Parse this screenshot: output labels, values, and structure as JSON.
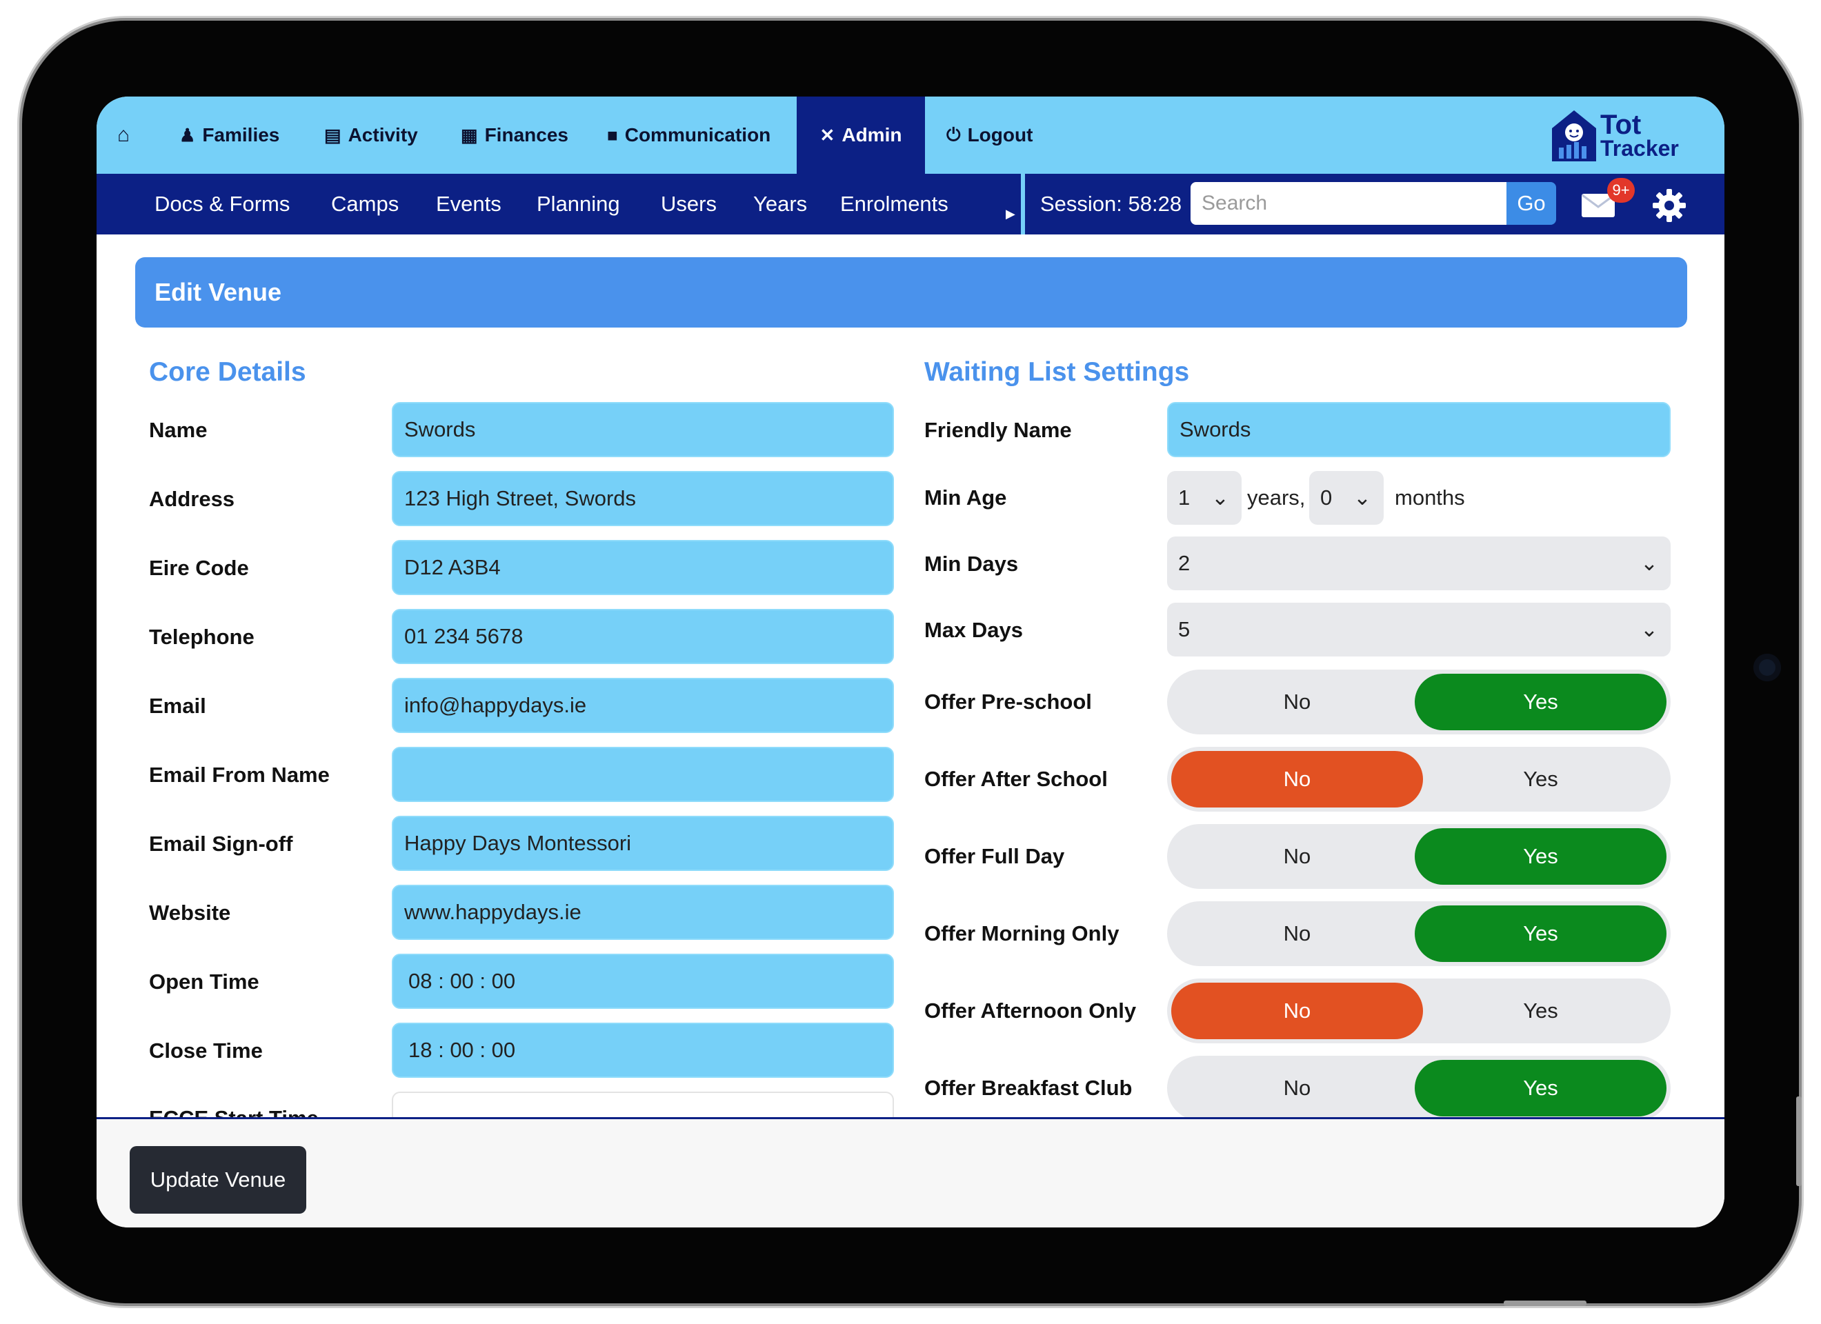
{
  "topnav": {
    "home_icon": "home-icon",
    "items": [
      {
        "label": "Families",
        "icon": "users-icon"
      },
      {
        "label": "Activity",
        "icon": "clipboard-icon"
      },
      {
        "label": "Finances",
        "icon": "ledger-icon"
      },
      {
        "label": "Communication",
        "icon": "chat-icon"
      },
      {
        "label": "Admin",
        "icon": "tools-icon"
      },
      {
        "label": "Logout",
        "icon": "power-icon"
      }
    ],
    "logo": {
      "line1": "Tot",
      "line2": "Tracker"
    }
  },
  "subnav": {
    "links": [
      "Docs & Forms",
      "Camps",
      "Events",
      "Planning",
      "Users",
      "Years",
      "Enrolments"
    ],
    "more_icon": "caret-right-icon",
    "session": "Session: 58:28",
    "search_placeholder": "Search",
    "go_label": "Go",
    "badge": "9+"
  },
  "page": {
    "title": "Edit Venue"
  },
  "core": {
    "title": "Core Details",
    "fields": [
      {
        "label": "Name",
        "value": "Swords"
      },
      {
        "label": "Address",
        "value": "123 High Street, Swords"
      },
      {
        "label": "Eire Code",
        "value": "D12 A3B4"
      },
      {
        "label": "Telephone",
        "value": "01 234 5678"
      },
      {
        "label": "Email",
        "value": "info@happydays.ie"
      },
      {
        "label": "Email From Name",
        "value": ""
      },
      {
        "label": "Email Sign-off",
        "value": "Happy Days Montessori"
      },
      {
        "label": "Website",
        "value": "www.happydays.ie"
      },
      {
        "label": "Open Time",
        "value": "08 : 00 : 00"
      },
      {
        "label": "Close Time",
        "value": "18 : 00 : 00"
      },
      {
        "label": "ECCE Start Time",
        "value": ""
      }
    ]
  },
  "waiting": {
    "title": "Waiting List Settings",
    "friendly_name": {
      "label": "Friendly Name",
      "value": "Swords"
    },
    "min_age": {
      "label": "Min Age",
      "years": "1",
      "years_unit": "years,",
      "months": "0",
      "months_unit": "months"
    },
    "min_days": {
      "label": "Min Days",
      "value": "2"
    },
    "max_days": {
      "label": "Max Days",
      "value": "5"
    },
    "toggles": [
      {
        "label": "Offer Pre-school",
        "no": "No",
        "yes": "Yes",
        "selected": "Yes"
      },
      {
        "label": "Offer After School",
        "no": "No",
        "yes": "Yes",
        "selected": "No"
      },
      {
        "label": "Offer Full Day",
        "no": "No",
        "yes": "Yes",
        "selected": "Yes"
      },
      {
        "label": "Offer Morning Only",
        "no": "No",
        "yes": "Yes",
        "selected": "Yes"
      },
      {
        "label": "Offer Afternoon Only",
        "no": "No",
        "yes": "Yes",
        "selected": "No"
      },
      {
        "label": "Offer Breakfast Club",
        "no": "No",
        "yes": "Yes",
        "selected": "Yes"
      }
    ]
  },
  "footer": {
    "update_label": "Update Venue"
  },
  "colors": {
    "nav_light": "#76d0f8",
    "nav_dark": "#0c2085",
    "accent": "#4a92ec",
    "yes": "#0b8a1e",
    "no": "#e25122"
  }
}
